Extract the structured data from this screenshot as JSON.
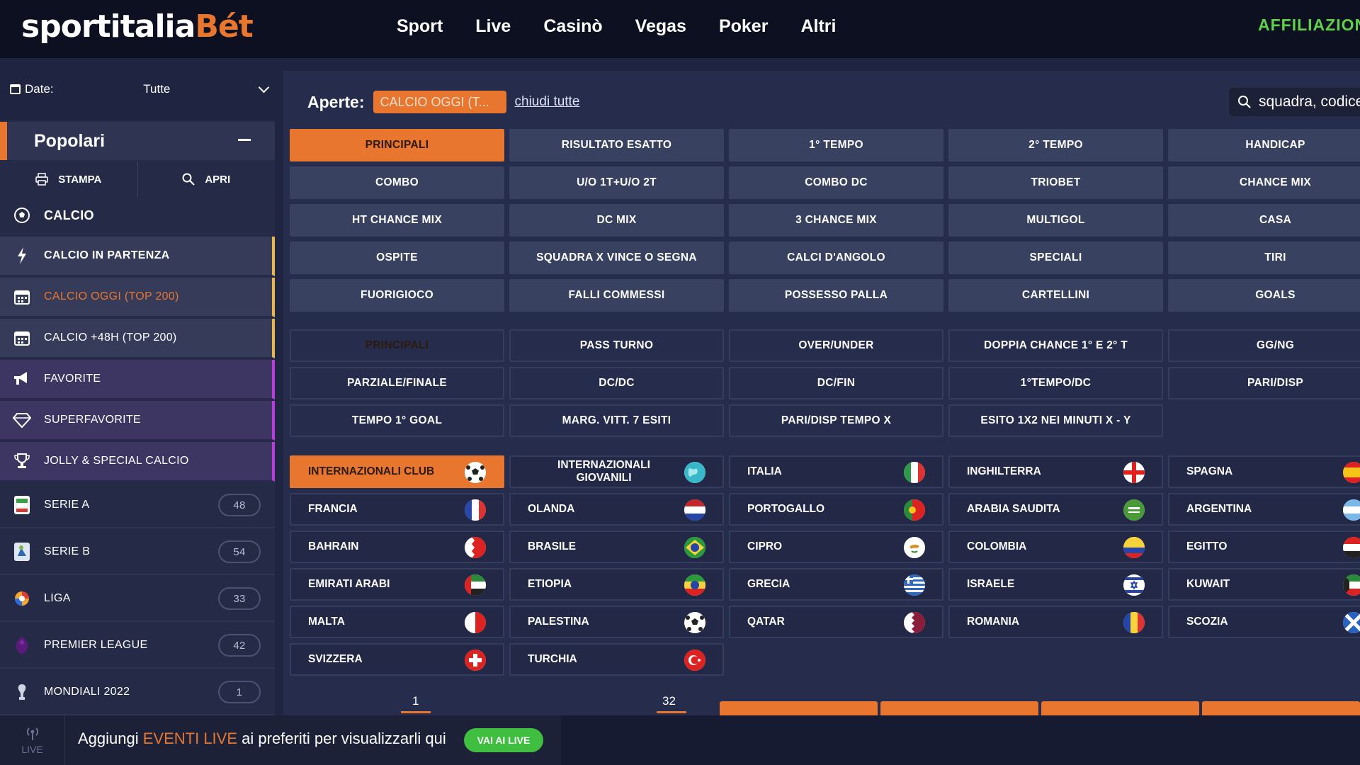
{
  "header": {
    "logo_part1": "sportitalia",
    "logo_part2": "Bét",
    "nav": [
      "Sport",
      "Live",
      "Casinò",
      "Vegas",
      "Poker",
      "Altri"
    ],
    "affiliation": "AFFILIAZIONI"
  },
  "sidebar": {
    "date_label": "Date:",
    "date_value": "Tutte",
    "popular_title": "Popolari",
    "print_label": "STAMPA",
    "open_label": "APRI",
    "items": [
      {
        "label": "CALCIO",
        "icon": "soccer-ball-icon"
      },
      {
        "label": "CALCIO IN PARTENZA",
        "icon": "lightning-icon"
      },
      {
        "label": "CALCIO OGGI (TOP 200)",
        "icon": "calendar-icon"
      },
      {
        "label": "CALCIO +48H (TOP 200)",
        "icon": "calendar-icon"
      },
      {
        "label": "FAVORITE",
        "icon": "megaphone-icon"
      },
      {
        "label": "SUPERFAVORITE",
        "icon": "diamond-icon"
      },
      {
        "label": "JOLLY & SPECIAL CALCIO",
        "icon": "trophy-icon"
      },
      {
        "label": "SERIE A",
        "icon": "serie-a-logo-icon",
        "count": "48"
      },
      {
        "label": "SERIE B",
        "icon": "serie-b-logo-icon",
        "count": "54"
      },
      {
        "label": "LIGA",
        "icon": "liga-logo-icon",
        "count": "33"
      },
      {
        "label": "PREMIER LEAGUE",
        "icon": "premier-league-logo-icon",
        "count": "42"
      },
      {
        "label": "MONDIALI 2022",
        "icon": "world-cup-trophy-icon",
        "count": "1"
      }
    ]
  },
  "open_bar": {
    "label": "Aperte:",
    "chip": "CALCIO OGGI (T...",
    "close_all": "chiudi tutte",
    "search_placeholder": "squadra, codice"
  },
  "markets_top": [
    "PRINCIPALI",
    "RISULTATO ESATTO",
    "1° TEMPO",
    "2° TEMPO",
    "HANDICAP",
    "COMBO",
    "U/O 1T+U/O 2T",
    "COMBO DC",
    "TRIOBET",
    "CHANCE MIX",
    "HT CHANCE MIX",
    "DC MIX",
    "3 CHANCE MIX",
    "MULTIGOL",
    "CASA",
    "OSPITE",
    "SQUADRA X VINCE O SEGNA",
    "CALCI D'ANGOLO",
    "SPECIALI",
    "TIRI",
    "FUORIGIOCO",
    "FALLI COMMESSI",
    "POSSESSO PALLA",
    "CARTELLINI",
    "GOALS"
  ],
  "markets_sub": [
    "PRINCIPALI",
    "PASS TURNO",
    "OVER/UNDER",
    "DOPPIA CHANCE 1° E 2° T",
    "GG/NG",
    "PARZIALE/FINALE",
    "DC/DC",
    "DC/FIN",
    "1°TEMPO/DC",
    "PARI/DISP",
    "TEMPO 1° GOAL",
    "MARG. VITT. 7 ESITI",
    "PARI/DISP TEMPO X",
    "ESITO 1X2 NEI MINUTI X - Y"
  ],
  "countries": [
    {
      "name": "INTERNAZIONALI CLUB",
      "flag": "soccer-ball"
    },
    {
      "name": "INTERNAZIONALI GIOVANILI",
      "flag": "globe"
    },
    {
      "name": "ITALIA",
      "flag": "italy"
    },
    {
      "name": "INGHILTERRA",
      "flag": "england"
    },
    {
      "name": "SPAGNA",
      "flag": "spain"
    },
    {
      "name": "FRANCIA",
      "flag": "france"
    },
    {
      "name": "OLANDA",
      "flag": "netherlands"
    },
    {
      "name": "PORTOGALLO",
      "flag": "portugal"
    },
    {
      "name": "ARABIA SAUDITA",
      "flag": "saudi-arabia"
    },
    {
      "name": "ARGENTINA",
      "flag": "argentina"
    },
    {
      "name": "BAHRAIN",
      "flag": "bahrain"
    },
    {
      "name": "BRASILE",
      "flag": "brazil"
    },
    {
      "name": "CIPRO",
      "flag": "cyprus"
    },
    {
      "name": "COLOMBIA",
      "flag": "colombia"
    },
    {
      "name": "EGITTO",
      "flag": "egypt"
    },
    {
      "name": "EMIRATI ARABI",
      "flag": "uae"
    },
    {
      "name": "ETIOPIA",
      "flag": "ethiopia"
    },
    {
      "name": "GRECIA",
      "flag": "greece"
    },
    {
      "name": "ISRAELE",
      "flag": "israel"
    },
    {
      "name": "KUWAIT",
      "flag": "kuwait"
    },
    {
      "name": "MALTA",
      "flag": "malta"
    },
    {
      "name": "PALESTINA",
      "flag": "soccer-ball"
    },
    {
      "name": "QATAR",
      "flag": "qatar"
    },
    {
      "name": "ROMANIA",
      "flag": "romania"
    },
    {
      "name": "SCOZIA",
      "flag": "scotland"
    },
    {
      "name": "SVIZZERA",
      "flag": "switzerland"
    },
    {
      "name": "TURCHIA",
      "flag": "turkey"
    }
  ],
  "pager": {
    "first": "1",
    "second": "32"
  },
  "bottom": {
    "live_label": "LIVE",
    "text_before": "Aggiungi ",
    "text_highlight": "EVENTI LIVE",
    "text_after": " ai preferiti per visualizzarli qui",
    "button": "VAI AI LIVE"
  },
  "colors": {
    "accent": "#e8762f",
    "green": "#3fbe3f",
    "header": "#0c1020"
  }
}
